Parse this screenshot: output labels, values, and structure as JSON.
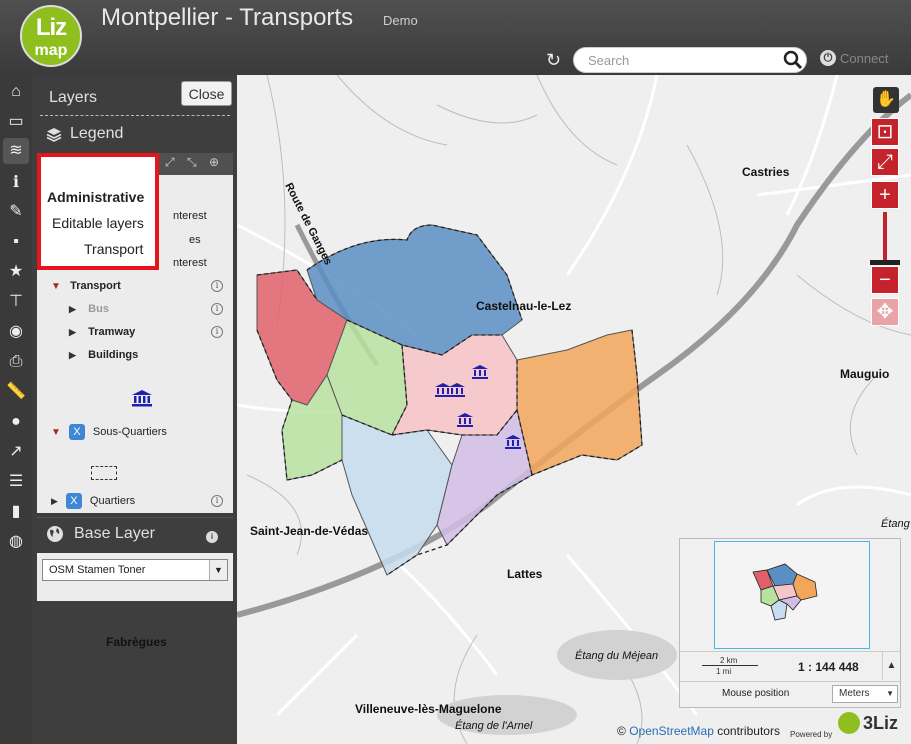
{
  "header": {
    "logo_top": "Liz",
    "logo_bottom": "map",
    "title": "Montpellier - Transports",
    "subtitle": "Demo",
    "search_placeholder": "Search",
    "connect_label": "Connect"
  },
  "panel": {
    "title": "Layers",
    "close_label": "Close",
    "legend_label": "Legend",
    "tree": {
      "partial1": "nterest",
      "partial2": "es",
      "partial3": "nterest",
      "transport": "Transport",
      "bus": "Bus",
      "tramway": "Tramway",
      "buildings": "Buildings",
      "sous_quartiers": "Sous-Quartiers",
      "quartiers": "Quartiers",
      "checkbox_mark": "X"
    },
    "base_layer_label": "Base Layer",
    "base_layer_value": "OSM Stamen Toner"
  },
  "dropdown": {
    "items": [
      "Administrative",
      "Editable layers",
      "Transport"
    ]
  },
  "map": {
    "places": {
      "castries": "Castries",
      "castelnau": "Castelnau-le-Lez",
      "mauguio": "Mauguio",
      "saint_jean": "Saint-Jean-de-Védas",
      "lattes": "Lattes",
      "fabregues": "Fabrègues",
      "villeneuve": "Villeneuve-lès-Maguelone",
      "route": "Route de Ganges",
      "etang_meja": "Étang du Méjean",
      "etang_arnel": "Étang de l'Arnel",
      "etang_edge": "Étang"
    },
    "region_colors": {
      "north": "#5b8ec4",
      "west": "#e0606a",
      "center_west": "#b9e2a0",
      "center": "#f6c5c8",
      "east": "#f2a65a",
      "south_west": "#c6dcef",
      "south_east": "#d2bde6",
      "south_mid": "#b7d0ea"
    }
  },
  "overview": {
    "scale_km": "2 km",
    "scale_mi": "1 mi",
    "scale_ratio": "1 : 144 448",
    "mouse_position_label": "Mouse position",
    "unit": "Meters"
  },
  "footer": {
    "attribution_prefix": "©",
    "attribution_link": "OpenStreetMap",
    "attribution_suffix": "contributors",
    "powered_by": "Powered by",
    "brand": "3Liz"
  }
}
